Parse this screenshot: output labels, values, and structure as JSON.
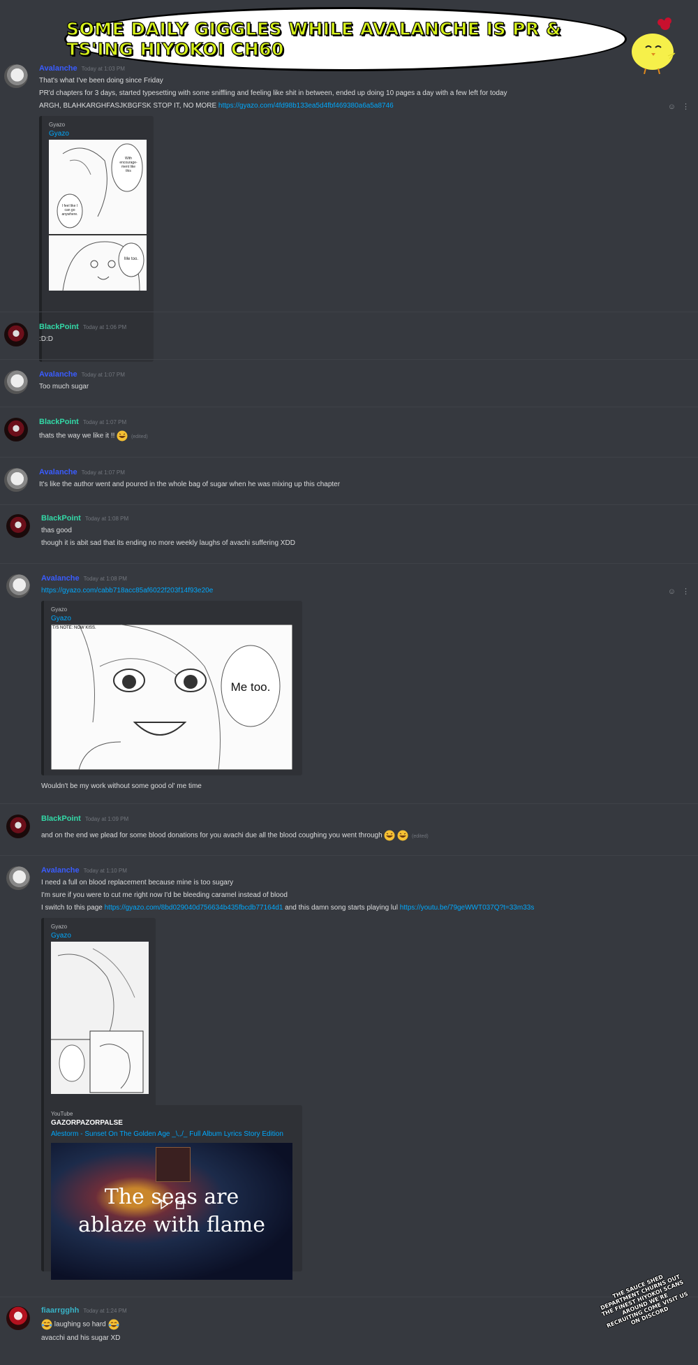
{
  "banner": {
    "text": "SOME DAILY GIGGLES WHILE AVALANCHE IS PR & TS'ING HIYOKOI CH60"
  },
  "embed_common": {
    "provider": "Gyazo",
    "title": "Gyazo"
  },
  "messages": [
    {
      "author": "Avalanche",
      "time": "Today at 1:03 PM",
      "lines": [
        "That's what I've been doing since Friday",
        "PR'd chapters for 3 days, started typesetting with some sniffling and feeling like shit in between, ended up doing 10 pages a day with a few left for today"
      ],
      "line3_text": "ARGH, BLAHKARGHFASJKBGFSK STOP IT, NO MORE",
      "line3_link": "https://gyazo.com/4fd98b133ea5d4fbf469380a6a5a8746",
      "manga_text": [
        "With encourage-ment like this",
        "I feel like I can go anywhere.",
        "Me too."
      ]
    },
    {
      "author": "BlackPoint",
      "time": "Today at 1:06 PM",
      "text": ":D:D"
    },
    {
      "author": "Avalanche",
      "time": "Today at 1:07 PM",
      "text": "Too much sugar"
    },
    {
      "author": "BlackPoint",
      "time": "Today at 1:07 PM",
      "text": "thats the way we like it !!",
      "edited": "(edited)"
    },
    {
      "author": "Avalanche",
      "time": "Today at 1:07 PM",
      "text": "It's like the author went and poured in the whole bag of sugar when he was mixing up this chapter"
    },
    {
      "author": "BlackPoint",
      "time": "Today at 1:08 PM",
      "lines": [
        "thas good",
        "though it is abit sad that its ending no more weekly laughs of avachi suffering XDD"
      ]
    },
    {
      "author": "Avalanche",
      "time": "Today at 1:08 PM",
      "link": "https://gyazo.com/cabb718acc85af6022f203f14f93e20e",
      "manga_note": "T/S NOTE: NOW KISS.",
      "manga_bubble": "Me too.",
      "after": "Wouldn't be my work without some good ol' me time"
    },
    {
      "author": "BlackPoint",
      "time": "Today at 1:09 PM",
      "text": "and on the end we plead for some blood donations for you avachi due all the blood coughing you went through",
      "edited": "(edited)"
    },
    {
      "author": "Avalanche",
      "time": "Today at 1:10 PM",
      "lines": [
        "I need a full on blood replacement because mine is too sugary",
        "I'm sure if you were to cut me right now I'd be bleeding caramel instead of blood"
      ],
      "line3_pre": "I switch to this page",
      "line3_link1": "https://gyazo.com/8bd029040d756634b435fbcdb77164d1",
      "line3_mid": "and this damn song starts playing lul",
      "line3_link2": "https://youtu.be/79geWWT037Q?t=33m33s",
      "youtube": {
        "provider": "YouTube",
        "author": "GAZORPAZORPALSE",
        "title": "Alestorm - Sunset On The Golden Age _\\,,/_ Full Album Lyrics Story Edition",
        "caption_1": "The seas are",
        "caption_2": "ablaze with flame"
      }
    },
    {
      "author": "fiaarrgghh",
      "time": "Today at 1:24 PM",
      "text": "laughing so hard",
      "line2": "avacchi and his sugar XD"
    }
  ],
  "credits": "THE SAUCE SHED DEPARTMENT CHURNS OUT THE FINEST HIYOKOI SCANS AROUND WE'RE RECRUITING COME VISIT US ON DISCORD",
  "colors": {
    "background": "#36393f",
    "avalanche": "#3a5cff",
    "blackpoint": "#33d9a7",
    "link": "#00a8fc"
  },
  "icons": [
    "add-reaction-icon",
    "more-options-icon",
    "grinning-emoji-icon",
    "tears-of-joy-emoji-icon",
    "chick-mascot-icon",
    "play-icon",
    "external-link-icon"
  ]
}
